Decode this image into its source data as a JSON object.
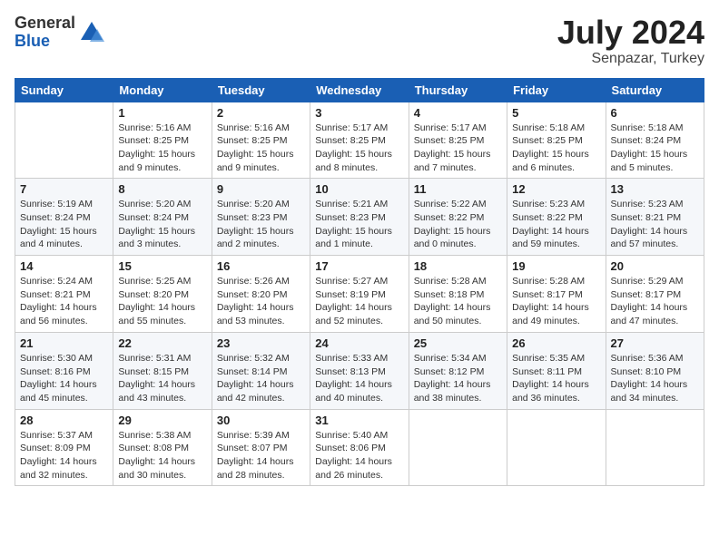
{
  "logo": {
    "general": "General",
    "blue": "Blue"
  },
  "header": {
    "month_year": "July 2024",
    "location": "Senpazar, Turkey"
  },
  "calendar": {
    "days_of_week": [
      "Sunday",
      "Monday",
      "Tuesday",
      "Wednesday",
      "Thursday",
      "Friday",
      "Saturday"
    ],
    "weeks": [
      [
        {
          "day": "",
          "info": ""
        },
        {
          "day": "1",
          "info": "Sunrise: 5:16 AM\nSunset: 8:25 PM\nDaylight: 15 hours\nand 9 minutes."
        },
        {
          "day": "2",
          "info": "Sunrise: 5:16 AM\nSunset: 8:25 PM\nDaylight: 15 hours\nand 9 minutes."
        },
        {
          "day": "3",
          "info": "Sunrise: 5:17 AM\nSunset: 8:25 PM\nDaylight: 15 hours\nand 8 minutes."
        },
        {
          "day": "4",
          "info": "Sunrise: 5:17 AM\nSunset: 8:25 PM\nDaylight: 15 hours\nand 7 minutes."
        },
        {
          "day": "5",
          "info": "Sunrise: 5:18 AM\nSunset: 8:25 PM\nDaylight: 15 hours\nand 6 minutes."
        },
        {
          "day": "6",
          "info": "Sunrise: 5:18 AM\nSunset: 8:24 PM\nDaylight: 15 hours\nand 5 minutes."
        }
      ],
      [
        {
          "day": "7",
          "info": "Sunrise: 5:19 AM\nSunset: 8:24 PM\nDaylight: 15 hours\nand 4 minutes."
        },
        {
          "day": "8",
          "info": "Sunrise: 5:20 AM\nSunset: 8:24 PM\nDaylight: 15 hours\nand 3 minutes."
        },
        {
          "day": "9",
          "info": "Sunrise: 5:20 AM\nSunset: 8:23 PM\nDaylight: 15 hours\nand 2 minutes."
        },
        {
          "day": "10",
          "info": "Sunrise: 5:21 AM\nSunset: 8:23 PM\nDaylight: 15 hours\nand 1 minute."
        },
        {
          "day": "11",
          "info": "Sunrise: 5:22 AM\nSunset: 8:22 PM\nDaylight: 15 hours\nand 0 minutes."
        },
        {
          "day": "12",
          "info": "Sunrise: 5:23 AM\nSunset: 8:22 PM\nDaylight: 14 hours\nand 59 minutes."
        },
        {
          "day": "13",
          "info": "Sunrise: 5:23 AM\nSunset: 8:21 PM\nDaylight: 14 hours\nand 57 minutes."
        }
      ],
      [
        {
          "day": "14",
          "info": "Sunrise: 5:24 AM\nSunset: 8:21 PM\nDaylight: 14 hours\nand 56 minutes."
        },
        {
          "day": "15",
          "info": "Sunrise: 5:25 AM\nSunset: 8:20 PM\nDaylight: 14 hours\nand 55 minutes."
        },
        {
          "day": "16",
          "info": "Sunrise: 5:26 AM\nSunset: 8:20 PM\nDaylight: 14 hours\nand 53 minutes."
        },
        {
          "day": "17",
          "info": "Sunrise: 5:27 AM\nSunset: 8:19 PM\nDaylight: 14 hours\nand 52 minutes."
        },
        {
          "day": "18",
          "info": "Sunrise: 5:28 AM\nSunset: 8:18 PM\nDaylight: 14 hours\nand 50 minutes."
        },
        {
          "day": "19",
          "info": "Sunrise: 5:28 AM\nSunset: 8:17 PM\nDaylight: 14 hours\nand 49 minutes."
        },
        {
          "day": "20",
          "info": "Sunrise: 5:29 AM\nSunset: 8:17 PM\nDaylight: 14 hours\nand 47 minutes."
        }
      ],
      [
        {
          "day": "21",
          "info": "Sunrise: 5:30 AM\nSunset: 8:16 PM\nDaylight: 14 hours\nand 45 minutes."
        },
        {
          "day": "22",
          "info": "Sunrise: 5:31 AM\nSunset: 8:15 PM\nDaylight: 14 hours\nand 43 minutes."
        },
        {
          "day": "23",
          "info": "Sunrise: 5:32 AM\nSunset: 8:14 PM\nDaylight: 14 hours\nand 42 minutes."
        },
        {
          "day": "24",
          "info": "Sunrise: 5:33 AM\nSunset: 8:13 PM\nDaylight: 14 hours\nand 40 minutes."
        },
        {
          "day": "25",
          "info": "Sunrise: 5:34 AM\nSunset: 8:12 PM\nDaylight: 14 hours\nand 38 minutes."
        },
        {
          "day": "26",
          "info": "Sunrise: 5:35 AM\nSunset: 8:11 PM\nDaylight: 14 hours\nand 36 minutes."
        },
        {
          "day": "27",
          "info": "Sunrise: 5:36 AM\nSunset: 8:10 PM\nDaylight: 14 hours\nand 34 minutes."
        }
      ],
      [
        {
          "day": "28",
          "info": "Sunrise: 5:37 AM\nSunset: 8:09 PM\nDaylight: 14 hours\nand 32 minutes."
        },
        {
          "day": "29",
          "info": "Sunrise: 5:38 AM\nSunset: 8:08 PM\nDaylight: 14 hours\nand 30 minutes."
        },
        {
          "day": "30",
          "info": "Sunrise: 5:39 AM\nSunset: 8:07 PM\nDaylight: 14 hours\nand 28 minutes."
        },
        {
          "day": "31",
          "info": "Sunrise: 5:40 AM\nSunset: 8:06 PM\nDaylight: 14 hours\nand 26 minutes."
        },
        {
          "day": "",
          "info": ""
        },
        {
          "day": "",
          "info": ""
        },
        {
          "day": "",
          "info": ""
        }
      ]
    ]
  }
}
